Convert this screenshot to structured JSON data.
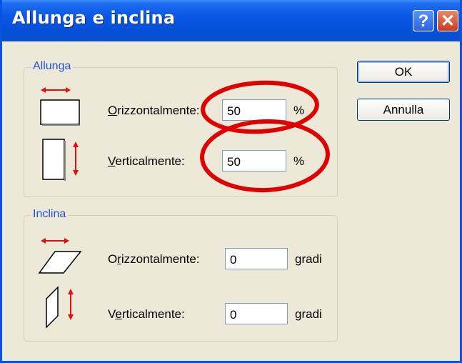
{
  "window": {
    "title": "Allunga e inclina",
    "help_glyph": "?",
    "close_glyph": "✕"
  },
  "stretch": {
    "group_label": "Allunga",
    "horizontal": {
      "label_key": "O",
      "label_rest": "rizzontalmente:",
      "value": "50",
      "unit": "%"
    },
    "vertical": {
      "label_key": "V",
      "label_rest": "erticalmente:",
      "value": "50",
      "unit": "%"
    }
  },
  "skew": {
    "group_label": "Inclina",
    "horizontal": {
      "label_pre": "O",
      "label_key": "r",
      "label_rest": "izzontalmente:",
      "value": "0",
      "unit": "gradi"
    },
    "vertical": {
      "label_pre": "V",
      "label_key": "e",
      "label_rest": "rticalmente:",
      "value": "0",
      "unit": "gradi"
    }
  },
  "buttons": {
    "ok": "OK",
    "cancel": "Annulla"
  },
  "icons": [
    "help-icon",
    "close-icon",
    "stretch-horizontal-icon",
    "stretch-vertical-icon",
    "skew-horizontal-icon",
    "skew-vertical-icon"
  ],
  "colors": {
    "title_bar": "#0a57e4",
    "group_label": "#2450d8",
    "annotation": "#e00000",
    "arrow": "#e01010"
  }
}
